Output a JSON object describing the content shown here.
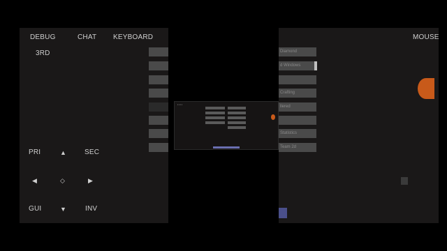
{
  "top_controls": {
    "debug": "DEBUG",
    "chat": "CHAT",
    "keyboard": "KEYBOARD",
    "mouse": "MOUSE",
    "third_person": "3RD"
  },
  "dpad": {
    "primary": "PRI",
    "secondary": "SEC",
    "up": "▲",
    "left": "◀",
    "center": "◇",
    "right": "▶",
    "down": "▼",
    "gui": "GUI",
    "inventory": "INV"
  },
  "right_menu": {
    "items": [
      "Diamond",
      "d Windows",
      "",
      "Crafting",
      "llered",
      "",
      "Statistics",
      "Team 2d"
    ]
  },
  "colors": {
    "panel": "#1a1818",
    "button": "#4a4a4a",
    "accent_orange": "#c85a1a",
    "accent_blue": "#4a4f8a"
  }
}
